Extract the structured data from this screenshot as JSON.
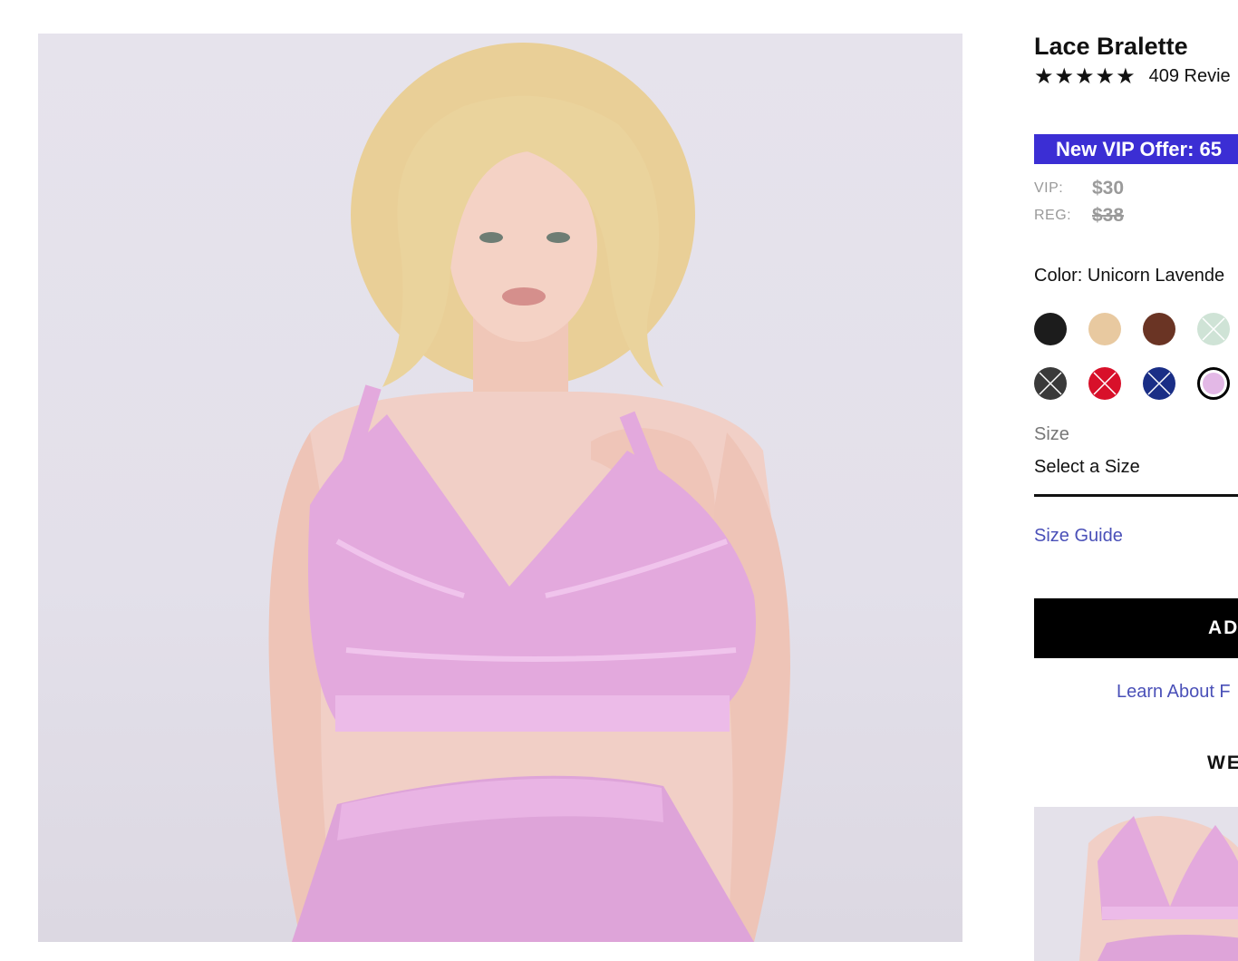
{
  "product": {
    "name": "Lace Bralette",
    "stars": "★★★★★",
    "reviews": "409 Revie"
  },
  "offer": {
    "banner": "New VIP Offer: 65",
    "vip_label": "VIP:",
    "vip_price": "$30",
    "reg_label": "REG:",
    "reg_price": "$38"
  },
  "color": {
    "label": "Color: Unicorn Lavende",
    "selected": "Unicorn Lavender",
    "swatches": [
      {
        "hex": "#1c1c1c",
        "available": true
      },
      {
        "hex": "#e8c9a0",
        "available": true
      },
      {
        "hex": "#6a3424",
        "available": true
      },
      {
        "hex": "#cfe3d6",
        "available": false
      },
      {
        "hex": "#3a3a3a",
        "available": false
      },
      {
        "hex": "#d8102a",
        "available": false
      },
      {
        "hex": "#1a2e86",
        "available": false
      },
      {
        "hex": "#e3b8e6",
        "available": true,
        "selected": true
      }
    ]
  },
  "size": {
    "label": "Size",
    "placeholder": "Select a Size",
    "guide": "Size Guide"
  },
  "actions": {
    "add_to_bag": "AD",
    "learn_more": "Learn About F"
  },
  "wear_with": {
    "heading": "WE"
  },
  "colors": {
    "accent": "#3b2ed4",
    "link": "#4a50b8",
    "product_pink": "#dfa6db"
  }
}
